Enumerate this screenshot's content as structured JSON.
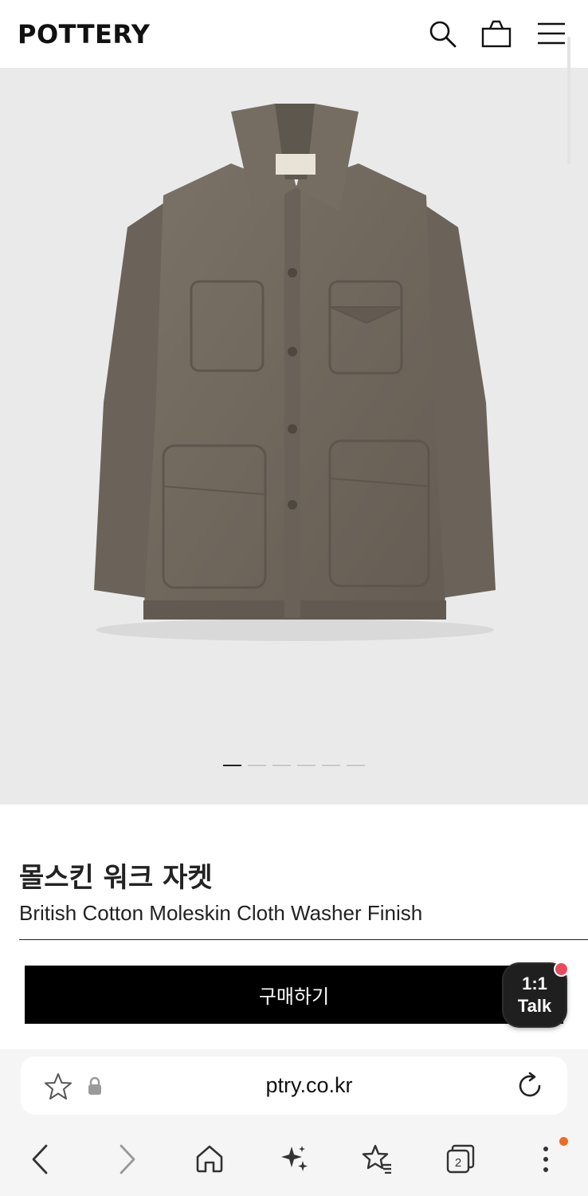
{
  "header": {
    "logo": "POTTERY",
    "icons": [
      "search-icon",
      "shopping-bag-icon",
      "hamburger-menu-icon"
    ]
  },
  "hero": {
    "image": "olive-brown moleskin work jacket on light grey background",
    "carousel_total": 6,
    "carousel_active_index": 1
  },
  "product": {
    "name": "몰스킨 워크 자켓",
    "subtitle": "British Cotton Moleskin Cloth Washer Finish"
  },
  "cta": {
    "buy_label": "구매하기",
    "talk_line1": "1:1",
    "talk_line2": "Talk"
  },
  "browser": {
    "url": "ptry.co.kr",
    "tab_count": "2",
    "icons": [
      "star-icon",
      "lock-icon",
      "reload-icon",
      "back-icon",
      "forward-icon",
      "home-icon",
      "sparkle-icon",
      "bookmarks-icon",
      "tabs-icon",
      "more-icon"
    ]
  },
  "colors": {
    "hero_bg": "#eaeaea",
    "jacket": "#6f675d",
    "button_bg": "#000000",
    "talk_badge": "#ea4a5e",
    "menu_badge": "#f26a21"
  }
}
